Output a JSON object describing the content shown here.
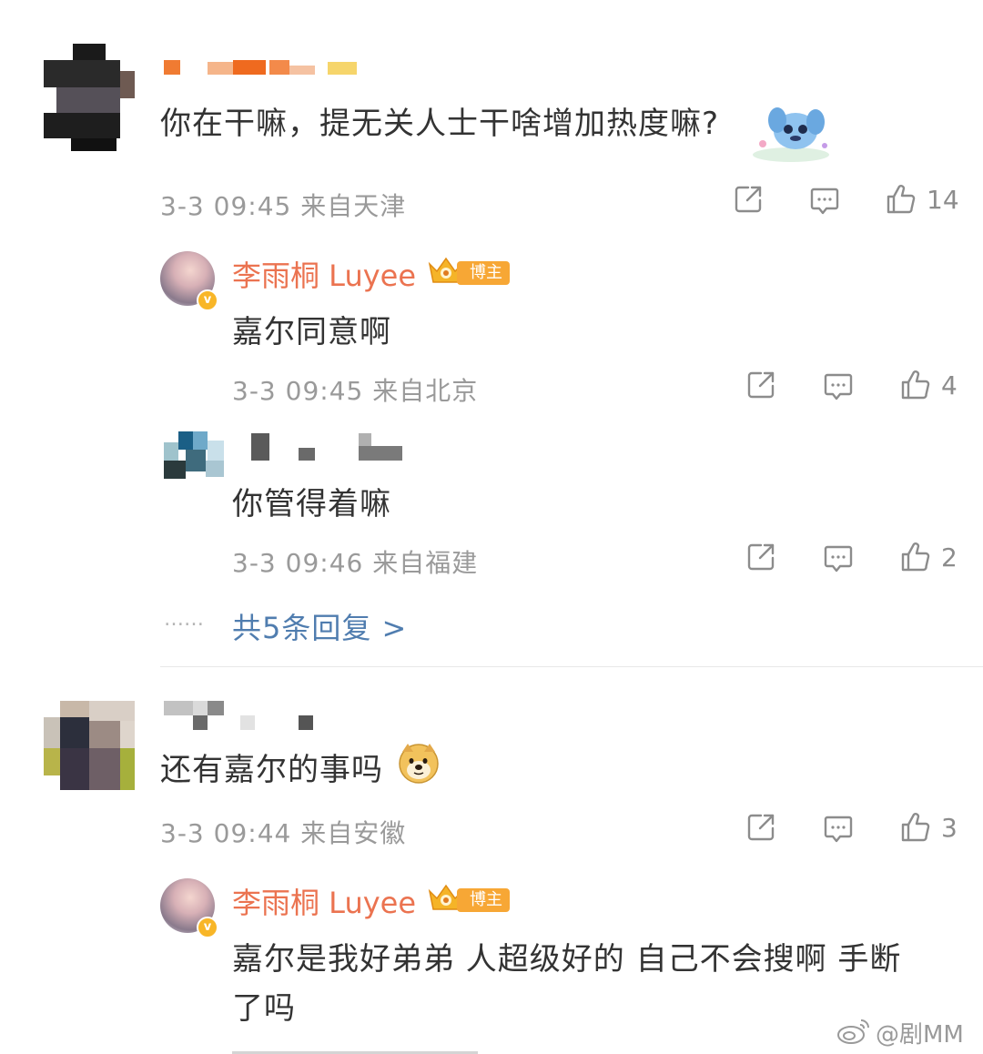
{
  "comments": [
    {
      "text": "你在干嘛，提无关人士干啥增加热度嘛?",
      "meta": "3-3 09:45 来自天津",
      "likes": "14",
      "replies": [
        {
          "name": "李雨桐 Luyee",
          "badge": "博主",
          "text": "嘉尔同意啊",
          "meta": "3-3 09:45 来自北京",
          "likes": "4"
        },
        {
          "text": "你管得着嘛",
          "meta": "3-3 09:46 来自福建",
          "likes": "2"
        }
      ],
      "more": {
        "dots": "……",
        "label": "共5条回复 >"
      }
    },
    {
      "text": "还有嘉尔的事吗",
      "meta": "3-3 09:44 来自安徽",
      "likes": "3",
      "replies": [
        {
          "name": "李雨桐 Luyee",
          "badge": "博主",
          "text_line1": "嘉尔是我好弟弟 人超级好的 自己不会搜啊 手断",
          "text_line2": "了吗"
        }
      ]
    }
  ],
  "watermark": "@剧MM",
  "colors": {
    "blogger": "#eb7350",
    "link": "#507daf",
    "meta": "#9a9a9a",
    "badge": "#f7a735"
  },
  "icons": [
    "share-icon",
    "comment-icon",
    "like-icon",
    "crown-icon",
    "verified-icon",
    "weibo-icon"
  ]
}
